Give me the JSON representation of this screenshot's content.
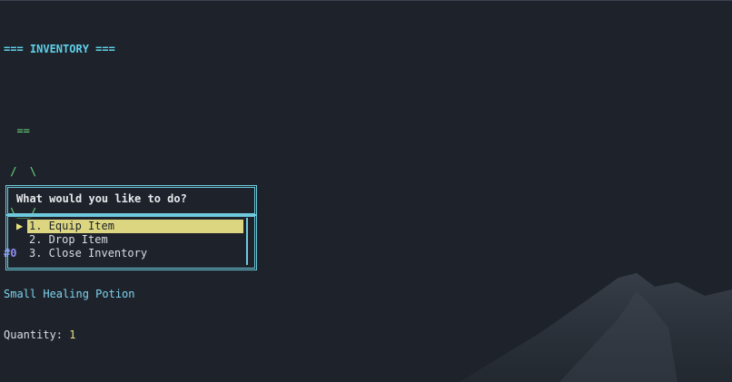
{
  "inventory": {
    "header": "=== INVENTORY ===",
    "art_lines": [
      "  ==",
      " /  \\",
      " \\__/"
    ],
    "item_id": "#0",
    "item_name": "Small Healing Potion",
    "quantity_label": "Quantity: ",
    "quantity_value": "1"
  },
  "dialog": {
    "prompt": "What would you like to do?",
    "cursor": "▶",
    "options": [
      {
        "label": "1. Equip Item",
        "selected": true
      },
      {
        "label": "2. Drop Item",
        "selected": false
      },
      {
        "label": "3. Close Inventory",
        "selected": false
      }
    ]
  },
  "colors": {
    "background": "#1e232b",
    "header": "#5fd0ea",
    "art": "#6fdc7e",
    "item_id": "#8f8cf0",
    "item_name": "#7fd3ef",
    "quantity": "#ecdf83",
    "frame": "#6ec9dc",
    "highlight": "#dcd680"
  }
}
